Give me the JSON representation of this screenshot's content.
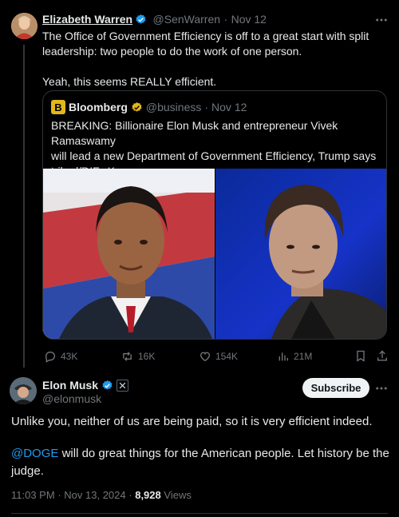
{
  "tweet": {
    "author_name": "Elizabeth Warren",
    "handle": "@SenWarren",
    "separator": "·",
    "date": "Nov 12",
    "text_line1": "The Office of Government Efficiency is off to a great start with split",
    "text_line2": "leadership:  two people to do the work of one person.",
    "text_line3": "Yeah, this seems REALLY efficient."
  },
  "quote": {
    "logo_letter": "B",
    "author_name": "Bloomberg",
    "handle": "@business",
    "separator": "·",
    "date": "Nov 12",
    "text_line1": "BREAKING: Billionaire Elon Musk and entrepreneur Vivek Ramaswamy",
    "text_line2": "will lead a new Department of Government Efficiency, Trump says",
    "text_line3": "trib.al/DIFwKsc"
  },
  "actions": {
    "replies": "43K",
    "reposts": "16K",
    "likes": "154K",
    "views": "21M"
  },
  "reply": {
    "author_name": "Elon Musk",
    "handle": "@elonmusk",
    "subscribe_label": "Subscribe",
    "text_line1": "Unlike you, neither of us are being paid, so it is very efficient indeed.",
    "mention": "@DOGE",
    "text_line2_rest": " will do great things for the American people. Let history be the",
    "text_line3": "judge.",
    "time": "11:03 PM",
    "separator": "·",
    "date": "Nov 13, 2024",
    "separator2": "·",
    "views_count": "8,928",
    "views_label": "Views"
  },
  "colors": {
    "background": "#000000",
    "text": "#e7e9ea",
    "muted": "#71767b",
    "link": "#1d9bf0",
    "verified_blue": "#1d9bf0",
    "verified_gold": "#e2b719"
  }
}
